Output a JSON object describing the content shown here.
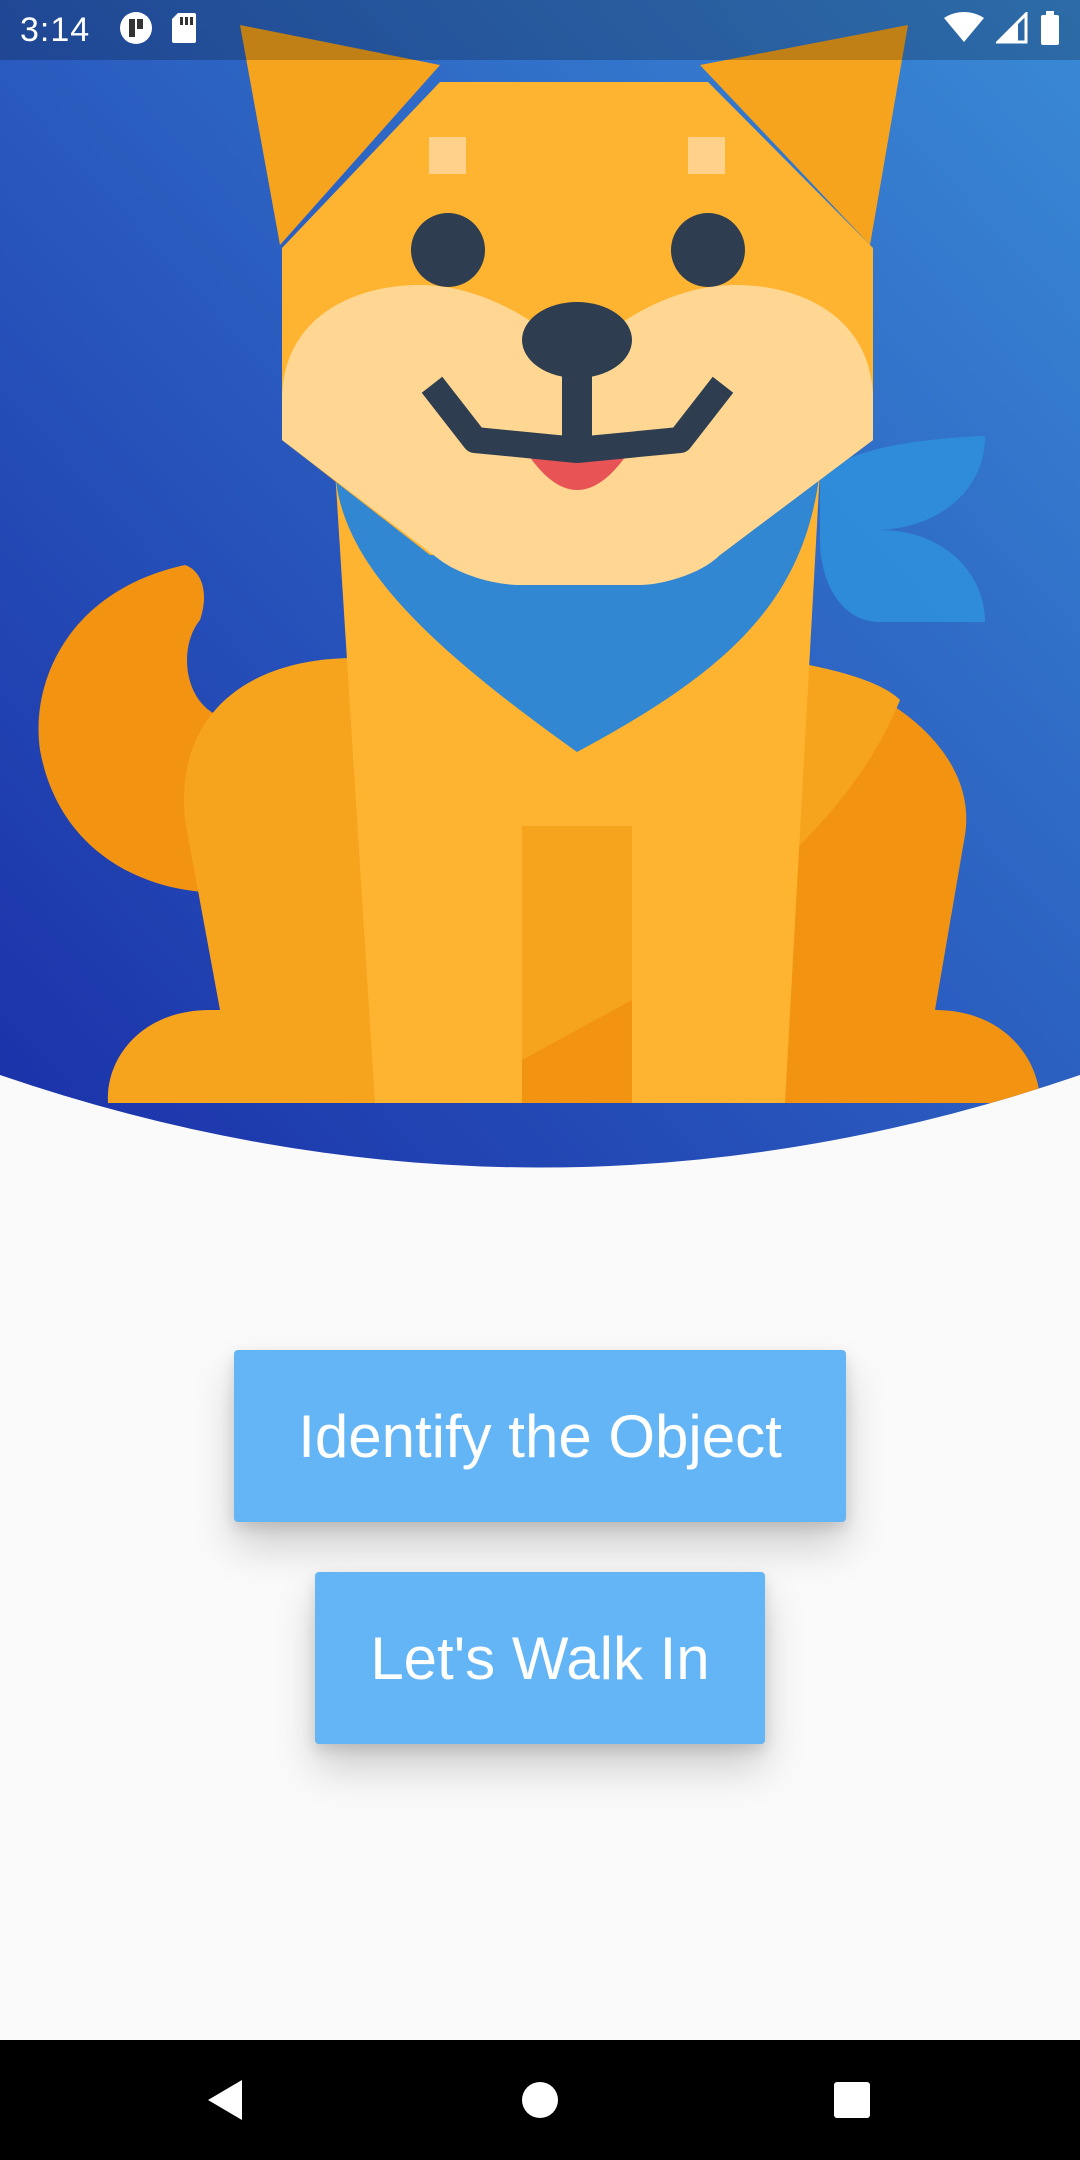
{
  "status_bar": {
    "time": "3:14",
    "left_icons": [
      "app-notification-icon",
      "sd-card-icon"
    ],
    "right_icons": [
      "wifi-icon",
      "signal-icon",
      "battery-icon"
    ]
  },
  "hero": {
    "illustration": "shiba-dog-with-bandana",
    "gradient_colors": [
      "#1a2fa8",
      "#3a8ad6"
    ]
  },
  "buttons": {
    "identify_label": "Identify the Object",
    "walk_label": "Let's Walk In"
  },
  "nav": {
    "icons": [
      "back-icon",
      "home-icon",
      "recents-icon"
    ]
  },
  "colors": {
    "button": "#64b5f6",
    "background": "#fafafa"
  }
}
